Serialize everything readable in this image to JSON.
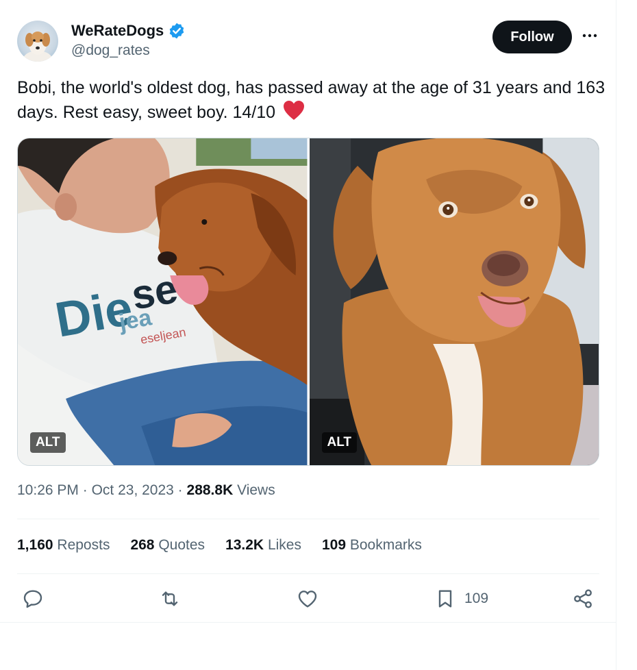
{
  "tweet": {
    "author": {
      "display_name": "WeRateDogs",
      "handle": "@dog_rates",
      "verified": true,
      "avatar_icon": "dog-avatar"
    },
    "follow_label": "Follow",
    "text": "Bobi, the world's oldest dog, has passed away at the age of 31 years and 163 days. Rest easy, sweet boy. 14/10",
    "emoji": "red-heart",
    "media": [
      {
        "alt_label": "ALT",
        "subject": "man-kissing-dog-photo"
      },
      {
        "alt_label": "ALT",
        "subject": "dog-portrait-photo"
      }
    ],
    "meta": {
      "time": "10:26 PM",
      "separator": "·",
      "date": "Oct 23, 2023",
      "views_count": "288.8K",
      "views_label": "Views"
    },
    "stats": {
      "reposts": {
        "count": "1,160",
        "label": "Reposts"
      },
      "quotes": {
        "count": "268",
        "label": "Quotes"
      },
      "likes": {
        "count": "13.2K",
        "label": "Likes"
      },
      "bookmarks": {
        "count": "109",
        "label": "Bookmarks"
      }
    },
    "actions": {
      "bookmark_count": "109"
    }
  },
  "colors": {
    "text_primary": "#0f1419",
    "text_secondary": "#536471",
    "verified_blue": "#1d9bf0",
    "heart_red": "#e0245e",
    "divider": "#eff3f4"
  }
}
